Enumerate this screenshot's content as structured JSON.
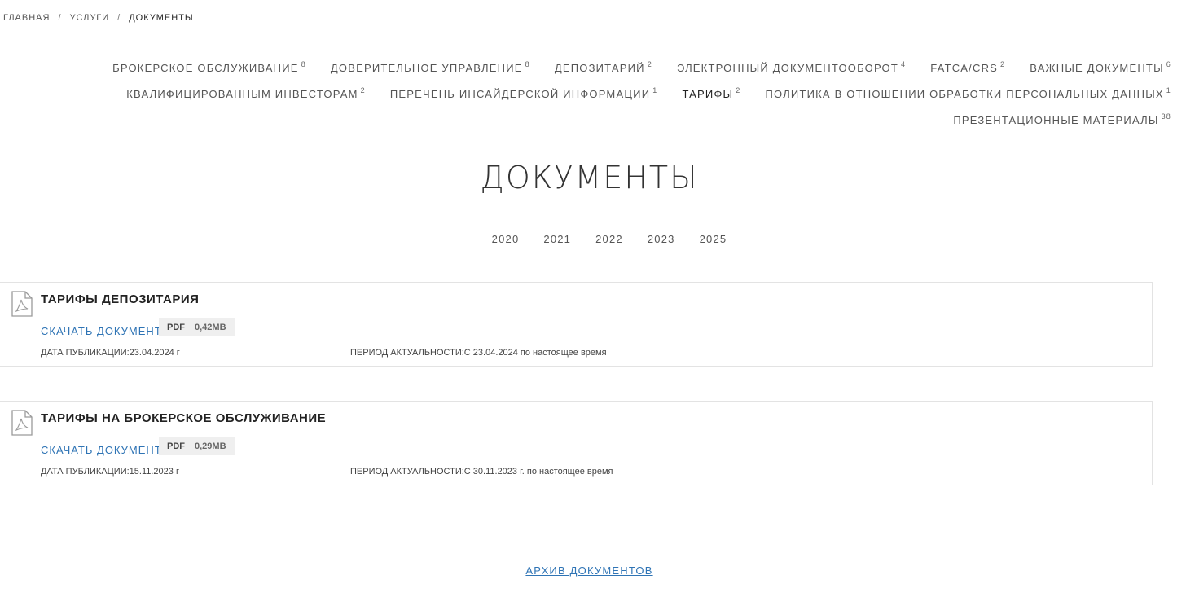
{
  "breadcrumb": {
    "items": [
      "ГЛАВНАЯ",
      "УСЛУГИ",
      "ДОКУМЕНТЫ"
    ],
    "separator": "/"
  },
  "categories": {
    "row1": [
      {
        "label": "БРОКЕРСКОЕ ОБСЛУЖИВАНИЕ",
        "count": "8"
      },
      {
        "label": "ДОВЕРИТЕЛЬНОЕ УПРАВЛЕНИЕ",
        "count": "8"
      },
      {
        "label": "ДЕПОЗИТАРИЙ",
        "count": "2"
      },
      {
        "label": "ЭЛЕКТРОННЫЙ ДОКУМЕНТООБОРОТ",
        "count": "4"
      },
      {
        "label": "FATCA/CRS",
        "count": "2"
      },
      {
        "label": "ВАЖНЫЕ ДОКУМЕНТЫ",
        "count": "6"
      }
    ],
    "row2": [
      {
        "label": "КВАЛИФИЦИРОВАННЫМ ИНВЕСТОРАМ",
        "count": "2"
      },
      {
        "label": "ПЕРЕЧЕНЬ ИНСАЙДЕРСКОЙ ИНФОРМАЦИИ",
        "count": "1"
      },
      {
        "label": "ТАРИФЫ",
        "count": "2",
        "active": true
      },
      {
        "label": "ПОЛИТИКА В ОТНОШЕНИИ ОБРАБОТКИ ПЕРСОНАЛЬНЫХ ДАННЫХ",
        "count": "1"
      }
    ],
    "row3": [
      {
        "label": "ПРЕЗЕНТАЦИОННЫЕ МАТЕРИАЛЫ",
        "count": "38"
      }
    ]
  },
  "page_title": "ДОКУМЕНТЫ",
  "years": [
    "2020",
    "2021",
    "2022",
    "2023",
    "2025"
  ],
  "documents": [
    {
      "title": "ТАРИФЫ ДЕПОЗИТАРИЯ",
      "download_label": "СКАЧАТЬ ДОКУМЕНТ",
      "file_type": "PDF",
      "file_size": "0,42MB",
      "published": "ДАТА ПУБЛИКАЦИИ:23.04.2024 г",
      "period": "ПЕРИОД АКТУАЛЬНОСТИ:С 23.04.2024 по настоящее время"
    },
    {
      "title": "ТАРИФЫ НА БРОКЕРСКОЕ ОБСЛУЖИВАНИЕ",
      "download_label": "СКАЧАТЬ ДОКУМЕНТ",
      "file_type": "PDF",
      "file_size": "0,29MB",
      "published": "ДАТА ПУБЛИКАЦИИ:15.11.2023 г",
      "period": "ПЕРИОД АКТУАЛЬНОСТИ:С 30.11.2023 г. по настоящее время"
    }
  ],
  "archive_label": "АРХИВ ДОКУМЕНТОВ",
  "colors": {
    "link": "#2f74b5",
    "text": "#333333",
    "badge_bg": "#efefef",
    "border": "#e3e3e3"
  },
  "icons": {
    "document": "pdf-file-icon"
  }
}
